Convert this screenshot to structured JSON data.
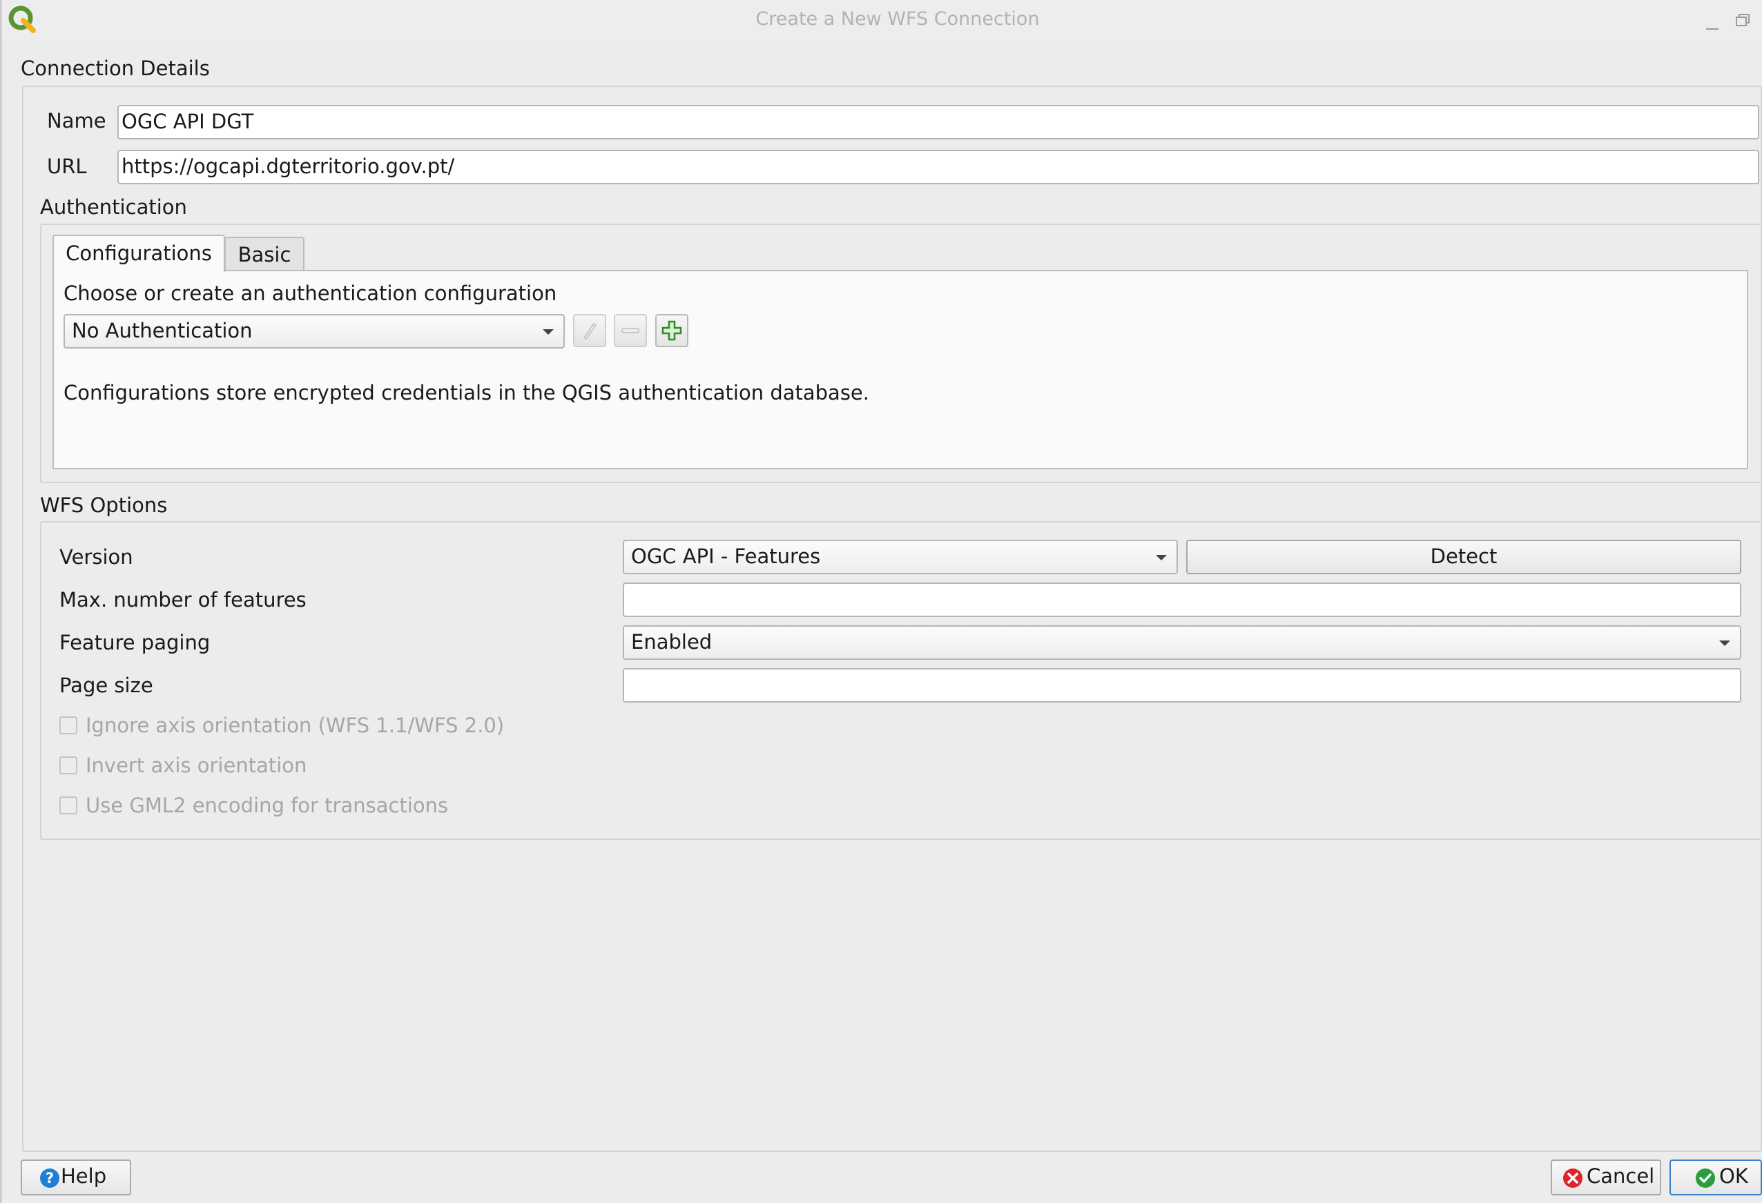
{
  "window": {
    "title": "Create a New WFS Connection",
    "logo_icon": "qgis-logo-icon",
    "minimize_icon": "minimize-icon",
    "restore_icon": "restore-icon"
  },
  "connection_details": {
    "title": "Connection Details",
    "name_label": "Name",
    "name_value": "OGC API DGT",
    "url_label": "URL",
    "url_value": "https://ogcapi.dgterritorio.gov.pt/"
  },
  "authentication": {
    "title": "Authentication",
    "tabs": [
      {
        "label": "Configurations",
        "active": true
      },
      {
        "label": "Basic",
        "active": false
      }
    ],
    "choose_label": "Choose or create an authentication configuration",
    "config_value": "No Authentication",
    "edit_icon": "pencil-icon",
    "remove_icon": "minus-icon",
    "add_icon": "plus-icon",
    "info_text": "Configurations store encrypted credentials in the QGIS authentication database."
  },
  "wfs_options": {
    "title": "WFS Options",
    "version_label": "Version",
    "version_value": "OGC API - Features",
    "detect_label": "Detect",
    "max_features_label": "Max. number of features",
    "max_features_value": "",
    "paging_label": "Feature paging",
    "paging_value": "Enabled",
    "page_size_label": "Page size",
    "page_size_value": "",
    "checkboxes": [
      {
        "label": "Ignore axis orientation (WFS 1.1/WFS 2.0)",
        "checked": false,
        "enabled": false
      },
      {
        "label": "Invert axis orientation",
        "checked": false,
        "enabled": false
      },
      {
        "label": "Use GML2 encoding for transactions",
        "checked": false,
        "enabled": false
      }
    ]
  },
  "footer": {
    "help_label": "Help",
    "cancel_label": "Cancel",
    "ok_label": "OK",
    "help_icon": "help-icon",
    "cancel_icon": "cancel-icon",
    "ok_icon": "check-icon"
  },
  "colors": {
    "accent_green": "#589632",
    "help_blue": "#1e7fd6",
    "cancel_red": "#d9262c",
    "ok_green": "#2a9d3c"
  }
}
